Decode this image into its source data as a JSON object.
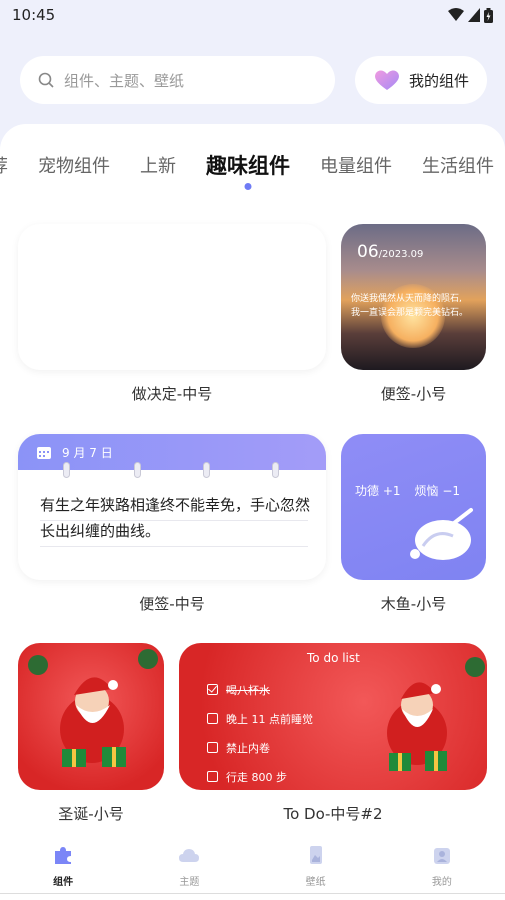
{
  "status_bar": {
    "time": "10:45"
  },
  "search": {
    "placeholder": "组件、主题、壁纸"
  },
  "header": {
    "my_widgets_label": "我的组件"
  },
  "tabs": [
    {
      "label": "荐"
    },
    {
      "label": "宠物组件"
    },
    {
      "label": "上新"
    },
    {
      "label": "趣味组件",
      "active": true
    },
    {
      "label": "电量组件"
    },
    {
      "label": "生活组件"
    }
  ],
  "cards": {
    "decision_medium": {
      "caption": "做决定-中号"
    },
    "memo_small": {
      "caption": "便签-小号",
      "day": "06",
      "year_month": "/2023.09",
      "quote_line1": "你送我偶然从天而降的陨石,",
      "quote_line2": "我一直误会那是颗完美钻石。"
    },
    "memo_medium": {
      "caption": "便签-中号",
      "date": "9 月 7 日",
      "text": "有生之年狭路相逢终不能幸免，手心忽然长出纠缠的曲线。"
    },
    "wooden_fish_small": {
      "caption": "木鱼-小号",
      "merit": "功德 +1",
      "trouble": "烦恼 −1"
    },
    "christmas_small": {
      "caption": "圣诞-小号"
    },
    "todo_medium": {
      "caption": "To Do-中号#2",
      "title": "To do list",
      "items": [
        {
          "text": "喝八杯水",
          "done": true
        },
        {
          "text": "晚上 11 点前睡觉",
          "done": false
        },
        {
          "text": "禁止内卷",
          "done": false
        },
        {
          "text": "行走 800 步",
          "done": false
        }
      ]
    }
  },
  "bottom_nav": [
    {
      "label": "组件",
      "icon": "puzzle-icon",
      "active": true
    },
    {
      "label": "主题",
      "icon": "cloud-icon",
      "active": false
    },
    {
      "label": "壁纸",
      "icon": "wallpaper-icon",
      "active": false
    },
    {
      "label": "我的",
      "icon": "profile-icon",
      "active": false
    }
  ],
  "colors": {
    "accent": "#6f7bf5",
    "memo_header": "#8b93f7",
    "xmas_red": "#e03232"
  }
}
